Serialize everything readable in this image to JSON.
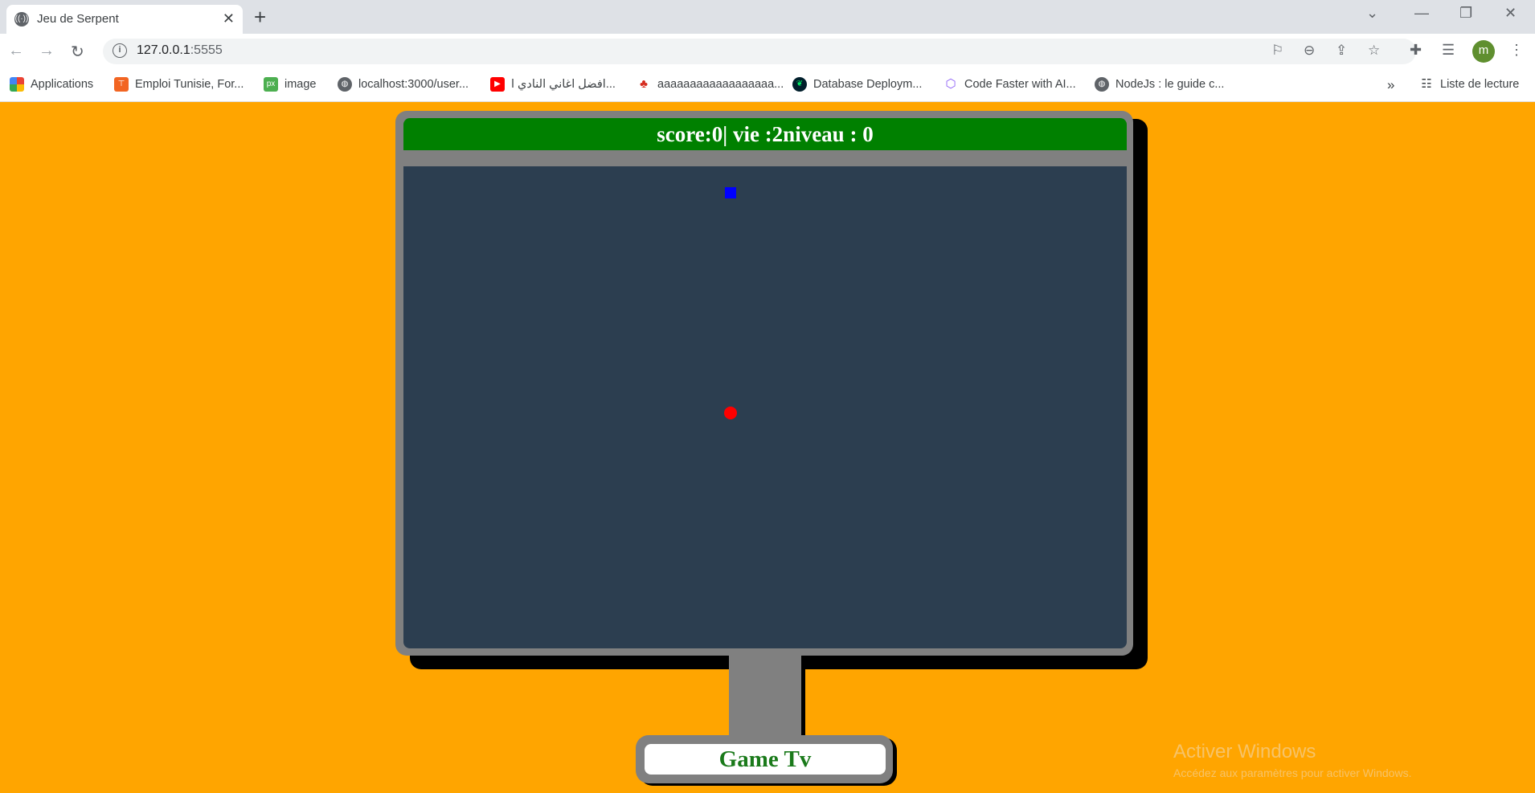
{
  "browser": {
    "tab_title": "Jeu de Serpent",
    "url_host": "127.0.0.1",
    "url_port": ":5555",
    "profile_initial": "m",
    "bookmarks": [
      {
        "label": "Applications",
        "icon": "apps-grid-icon"
      },
      {
        "label": "Emploi Tunisie, For...",
        "icon": "emploi-icon"
      },
      {
        "label": "image",
        "icon": "px-icon"
      },
      {
        "label": "localhost:3000/user...",
        "icon": "globe-icon"
      },
      {
        "label": "افضل اغاني النادي ا...",
        "icon": "youtube-icon"
      },
      {
        "label": "aaaaaaaaaaaaaaaaaa...",
        "icon": "maple-leaf-icon"
      },
      {
        "label": "Database Deploym...",
        "icon": "mongodb-icon"
      },
      {
        "label": "Code Faster with AI...",
        "icon": "code-icon"
      },
      {
        "label": "NodeJs : le guide c...",
        "icon": "globe-icon"
      }
    ],
    "more_bookmarks": "»",
    "reading_list": "Liste de lecture"
  },
  "game": {
    "status_text": "score:0| vie :2niveau : 0",
    "score": 0,
    "lives": 2,
    "level": 0,
    "snake": [
      {
        "col": 26,
        "row": 1
      }
    ],
    "food": {
      "col": 26,
      "row": 19
    },
    "grid": {
      "cols": 60,
      "rows": 40
    },
    "colors": {
      "board": "#2c3e50",
      "snake": "#0000ff",
      "food": "#ff0000",
      "header": "#008000",
      "frame": "#808080",
      "background": "#ffa500"
    }
  },
  "tv": {
    "brand_label": "Game Tv"
  },
  "watermark": {
    "title": "Activer Windows",
    "subtitle": "Accédez aux paramètres pour activer Windows."
  }
}
